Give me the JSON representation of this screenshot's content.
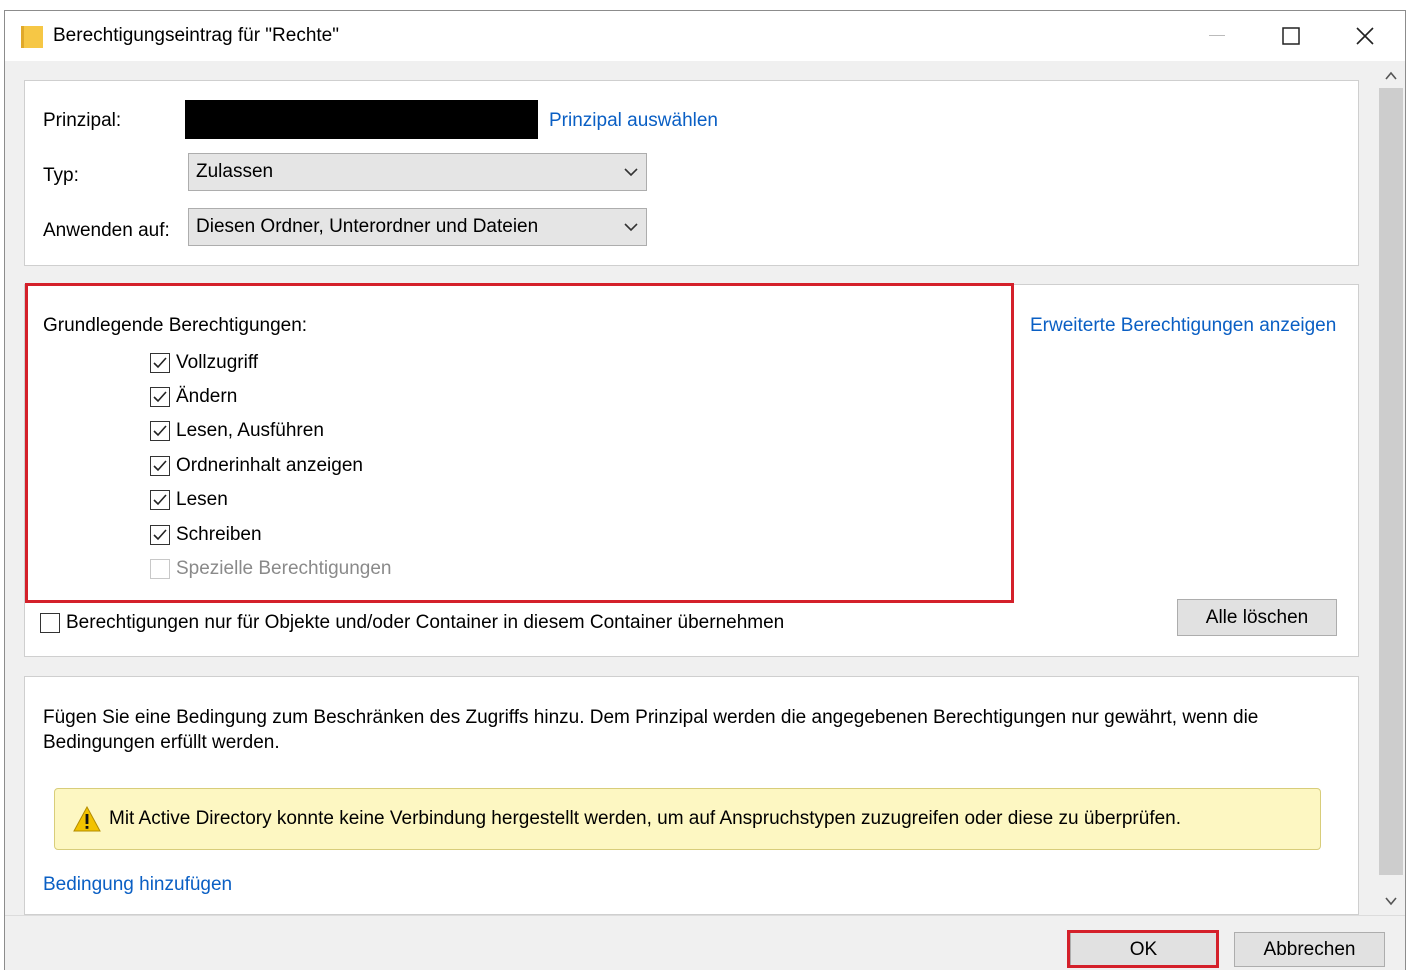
{
  "window": {
    "title": "Berechtigungseintrag für \"Rechte\"",
    "icons": [
      "folder-icon",
      "minimize-icon",
      "maximize-icon",
      "close-icon"
    ]
  },
  "principal": {
    "label": "Prinzipal:",
    "select_link": "Prinzipal auswählen"
  },
  "type": {
    "label": "Typ:",
    "value": "Zulassen"
  },
  "apply_to": {
    "label": "Anwenden auf:",
    "value": "Diesen Ordner, Unterordner und Dateien"
  },
  "basic_permissions": {
    "heading": "Grundlegende Berechtigungen:",
    "show_advanced_link": "Erweiterte Berechtigungen anzeigen",
    "items": [
      {
        "label": "Vollzugriff",
        "checked": true,
        "enabled": true
      },
      {
        "label": "Ändern",
        "checked": true,
        "enabled": true
      },
      {
        "label": "Lesen, Ausführen",
        "checked": true,
        "enabled": true
      },
      {
        "label": "Ordnerinhalt anzeigen",
        "checked": true,
        "enabled": true
      },
      {
        "label": "Lesen",
        "checked": true,
        "enabled": true
      },
      {
        "label": "Schreiben",
        "checked": true,
        "enabled": true
      },
      {
        "label": "Spezielle Berechtigungen",
        "checked": false,
        "enabled": false
      }
    ],
    "inherit_only": {
      "label": "Berechtigungen nur für Objekte und/oder Container in diesem Container übernehmen",
      "checked": false
    },
    "clear_all": "Alle löschen"
  },
  "condition": {
    "description": "Fügen Sie eine Bedingung zum Beschränken des Zugriffs hinzu. Dem Prinzipal werden die angegebenen Berechtigungen nur gewährt, wenn die Bedingungen erfüllt werden.",
    "warning": "Mit Active Directory konnte keine Verbindung hergestellt werden, um auf Anspruchstypen zuzugreifen oder diese zu überprüfen.",
    "add_link": "Bedingung hinzufügen"
  },
  "footer": {
    "ok": "OK",
    "cancel": "Abbrechen"
  },
  "colors": {
    "highlight": "#d4202a",
    "link": "#0a5fc4",
    "warning_bg": "#fdf7c2"
  }
}
